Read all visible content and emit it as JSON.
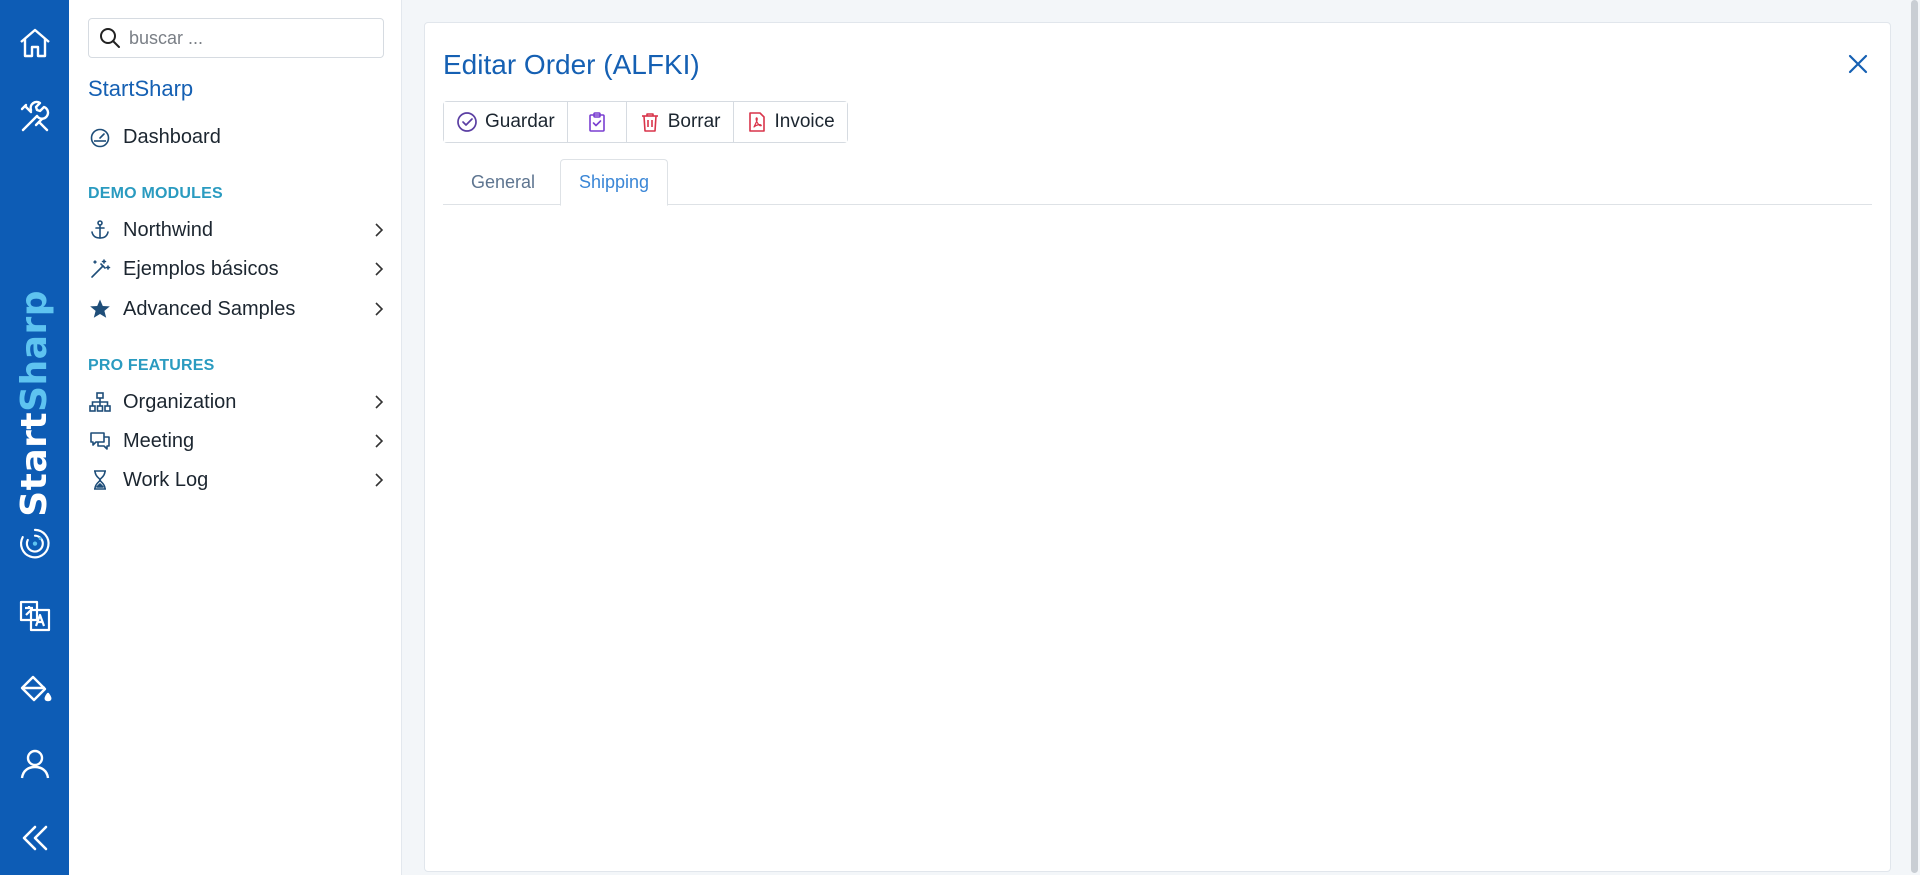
{
  "rail": {
    "brand_part1": "Start",
    "brand_part2": "Sharp",
    "items": [
      {
        "icon": "home-icon"
      },
      {
        "icon": "tools-icon"
      },
      {
        "icon": "translate-icon"
      },
      {
        "icon": "paint-bucket-icon"
      },
      {
        "icon": "user-icon"
      },
      {
        "icon": "collapse-icon"
      }
    ]
  },
  "sidebar": {
    "search_placeholder": "buscar ...",
    "app_title": "StartSharp",
    "dashboard": "Dashboard",
    "section_demo": "DEMO MODULES",
    "northwind": "Northwind",
    "basic_samples": "Ejemplos básicos",
    "advanced_samples": "Advanced Samples",
    "section_pro": "PRO FEATURES",
    "organization": "Organization",
    "meeting": "Meeting",
    "work_log": "Work Log"
  },
  "dialog": {
    "title": "Editar Order (ALFKI)",
    "toolbar": {
      "save": "Guardar",
      "delete": "Borrar",
      "invoice": "Invoice"
    },
    "tabs": [
      {
        "label": "General",
        "active": false
      },
      {
        "label": "Shipping",
        "active": true
      }
    ]
  },
  "colors": {
    "rail_bg": "#0d5cb5",
    "accent": "#1560b3",
    "section_label": "#2a9bc0",
    "delete_red": "#d9344a",
    "clipboard_purple": "#7a3fd1"
  }
}
